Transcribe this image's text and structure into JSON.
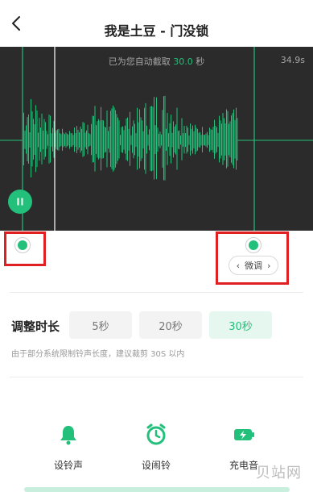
{
  "header": {
    "title": "我是土豆 - 门没锁"
  },
  "waveform": {
    "auto_prefix": "已为您自动截取 ",
    "auto_seconds": "30.0",
    "auto_suffix": " 秒",
    "total_duration": "34.9s"
  },
  "trim": {
    "fine_tune_label": "微调",
    "left_arrow": "‹",
    "right_arrow": "›"
  },
  "duration": {
    "label": "调整时长",
    "options": [
      "5秒",
      "20秒",
      "30秒"
    ],
    "selected": "30秒",
    "hint": "由于部分系统限制铃声长度，建议裁剪 30S 以内"
  },
  "actions": [
    {
      "label": "设铃声",
      "icon": "bell-icon"
    },
    {
      "label": "设闹铃",
      "icon": "alarm-clock-icon"
    },
    {
      "label": "充电音",
      "icon": "battery-charging-icon"
    }
  ],
  "watermark": "贝站网",
  "colors": {
    "accent": "#22c07a",
    "wave_bg": "#2b2b2b",
    "highlight": "#e02020"
  }
}
